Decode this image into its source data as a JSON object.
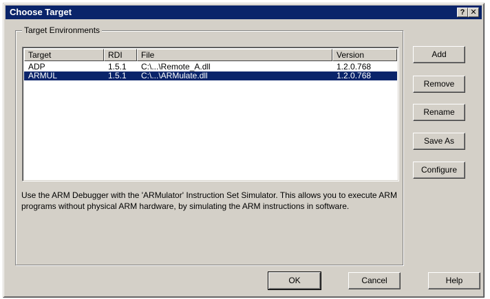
{
  "window": {
    "title": "Choose Target",
    "help_glyph": "?",
    "close_glyph": "✕"
  },
  "group": {
    "legend": "Target Environments"
  },
  "list": {
    "columns": [
      "Target",
      "RDI",
      "File",
      "Version"
    ],
    "rows": [
      {
        "target": "ADP",
        "rdi": "1.5.1",
        "file": "C:\\...\\Remote_A.dll",
        "version": "1.2.0.768",
        "selected": false
      },
      {
        "target": "ARMUL",
        "rdi": "1.5.1",
        "file": "C:\\...\\ARMulate.dll",
        "version": "1.2.0.768",
        "selected": true
      }
    ]
  },
  "side_buttons": {
    "add": "Add",
    "remove": "Remove",
    "rename": "Rename",
    "save_as": "Save As",
    "configure": "Configure"
  },
  "description": "Use the ARM Debugger with the 'ARMulator' Instruction Set Simulator. This allows you to execute ARM programs without physical ARM hardware, by simulating the ARM instructions in software.",
  "footer_buttons": {
    "ok": "OK",
    "cancel": "Cancel",
    "help": "Help"
  },
  "colors": {
    "titlebar": "#0a246a",
    "face": "#d4d0c8",
    "selection": "#0a246a"
  }
}
